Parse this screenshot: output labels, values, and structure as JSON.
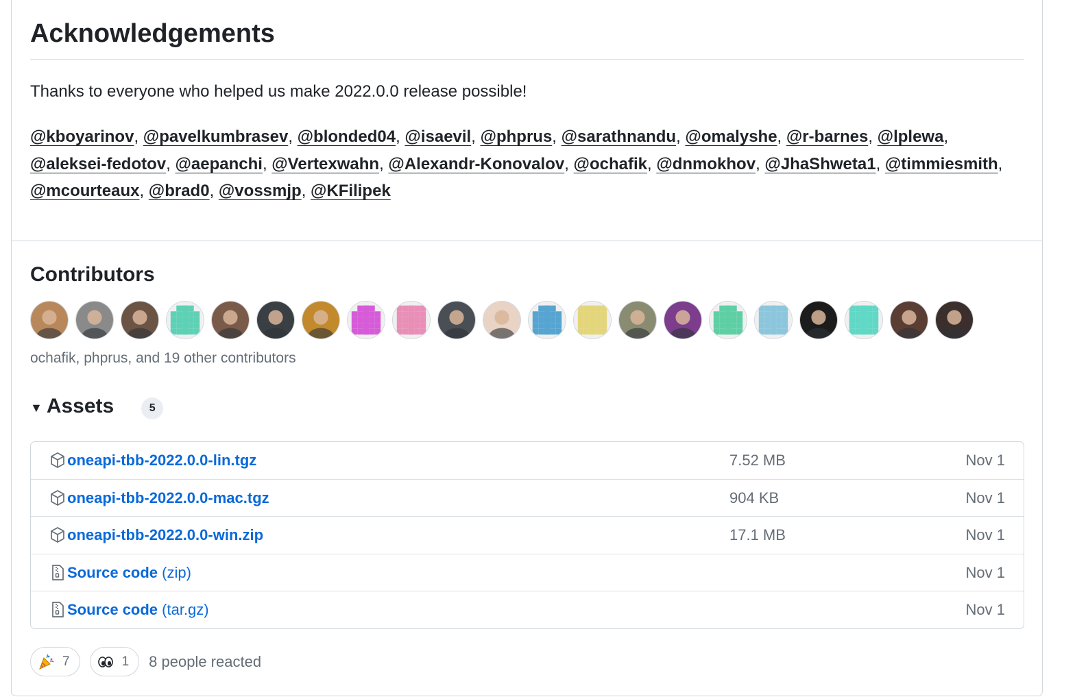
{
  "acknowledgements": {
    "title": "Acknowledgements",
    "thanks": "Thanks to everyone who helped us make 2022.0.0 release possible!",
    "mentions": [
      "@kboyarinov",
      "@pavelkumbrasev",
      "@blonded04",
      "@isaevil",
      "@phprus",
      "@sarathnandu",
      "@omalyshe",
      "@r-barnes",
      "@lplewa",
      "@aleksei-fedotov",
      "@aepanchi",
      "@Vertexwahn",
      "@Alexandr-Konovalov",
      "@ochafik",
      "@dnmokhov",
      "@JhaShweta1",
      "@timmiesmith",
      "@mcourteaux",
      "@brad0",
      "@vossmjp",
      "@KFilipek"
    ]
  },
  "contributors": {
    "title": "Contributors",
    "summary": "ochafik, phprus, and 19 other contributors",
    "avatars": [
      {
        "kind": "photo",
        "color": "#b9885a"
      },
      {
        "kind": "photo",
        "color": "#8a8a8a"
      },
      {
        "kind": "photo",
        "color": "#6b5444"
      },
      {
        "kind": "identicon",
        "color": "#5ed1b5"
      },
      {
        "kind": "photo",
        "color": "#7a5a48"
      },
      {
        "kind": "photo",
        "color": "#3a3f44"
      },
      {
        "kind": "photo",
        "color": "#c28a2c"
      },
      {
        "kind": "identicon",
        "color": "#d65bd8"
      },
      {
        "kind": "identicon",
        "color": "#e98fb7"
      },
      {
        "kind": "photo",
        "color": "#4a4f55"
      },
      {
        "kind": "photo",
        "color": "#e8d3c4"
      },
      {
        "kind": "identicon",
        "color": "#56a4d1"
      },
      {
        "kind": "identicon",
        "color": "#e3d57a"
      },
      {
        "kind": "photo",
        "color": "#8a8c72"
      },
      {
        "kind": "photo",
        "color": "#7b3d8c"
      },
      {
        "kind": "identicon",
        "color": "#5ecfa5"
      },
      {
        "kind": "identicon",
        "color": "#8cc6dc"
      },
      {
        "kind": "photo",
        "color": "#1c1c1c"
      },
      {
        "kind": "identicon",
        "color": "#5fd8c5"
      },
      {
        "kind": "photo",
        "color": "#5a3d33"
      },
      {
        "kind": "photo",
        "color": "#3b2f2d"
      }
    ]
  },
  "assets": {
    "title": "Assets",
    "count": "5",
    "rows": [
      {
        "icon": "package-icon",
        "name": "oneapi-tbb-2022.0.0-lin.tgz",
        "suffix": "",
        "size": "7.52 MB",
        "date": "Nov 1"
      },
      {
        "icon": "package-icon",
        "name": "oneapi-tbb-2022.0.0-mac.tgz",
        "suffix": "",
        "size": "904 KB",
        "date": "Nov 1"
      },
      {
        "icon": "package-icon",
        "name": "oneapi-tbb-2022.0.0-win.zip",
        "suffix": "",
        "size": "17.1 MB",
        "date": "Nov 1"
      },
      {
        "icon": "file-zip-icon",
        "name": "Source code",
        "suffix": "(zip)",
        "size": "",
        "date": "Nov 1"
      },
      {
        "icon": "file-zip-icon",
        "name": "Source code",
        "suffix": "(tar.gz)",
        "size": "",
        "date": "Nov 1"
      }
    ]
  },
  "reactions": {
    "items": [
      {
        "icon": "tada-icon",
        "count": "7"
      },
      {
        "icon": "eyes-icon",
        "count": "1"
      }
    ],
    "summary": "8 people reacted"
  },
  "colors": {
    "link": "#0969da",
    "text": "#1f2328",
    "muted": "#656d76",
    "border": "#d0d7de"
  }
}
